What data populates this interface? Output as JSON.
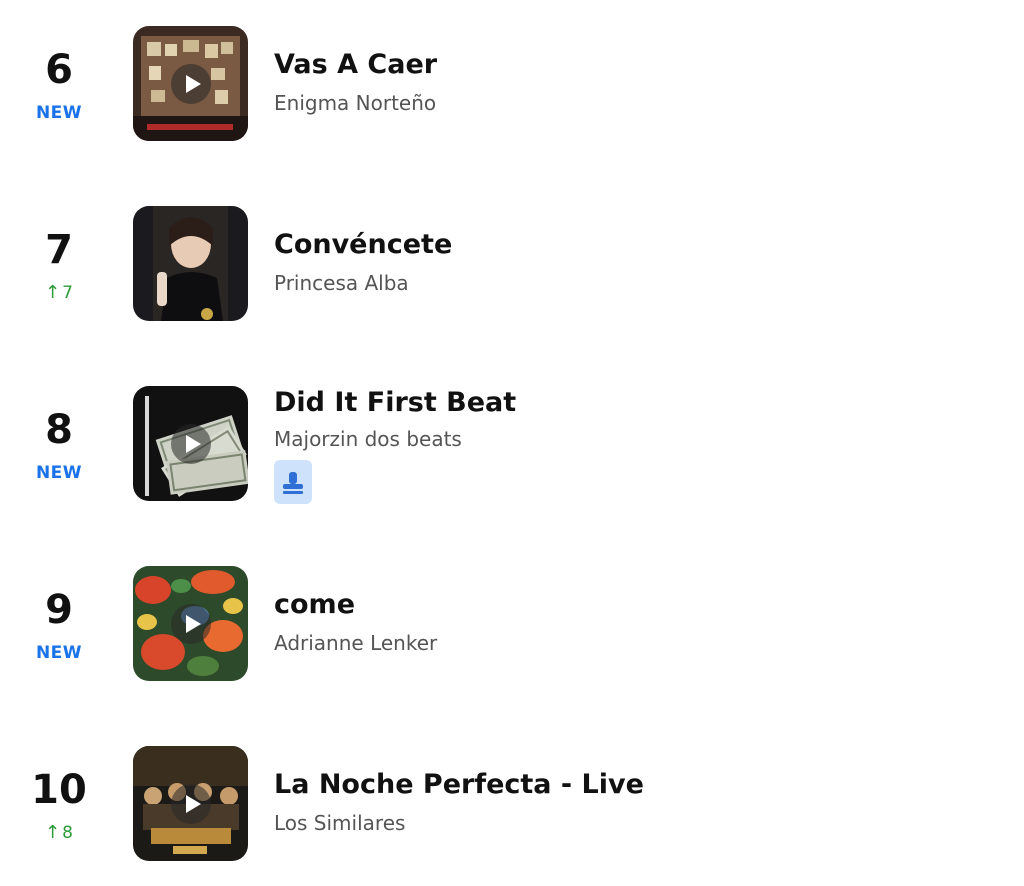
{
  "chart": {
    "entries": [
      {
        "rank": "6",
        "movement": "NEW",
        "movement_type": "new",
        "title": "Vas A Caer",
        "artist": "Enigma Norteño",
        "has_play_button": true,
        "has_badge": false
      },
      {
        "rank": "7",
        "movement": "7",
        "movement_type": "up",
        "title": "Convéncete",
        "artist": "Princesa Alba",
        "has_play_button": false,
        "has_badge": false
      },
      {
        "rank": "8",
        "movement": "NEW",
        "movement_type": "new",
        "title": "Did It First Beat",
        "artist": "Majorzin dos beats",
        "has_play_button": true,
        "has_badge": true,
        "badge_icon": "stamp-icon"
      },
      {
        "rank": "9",
        "movement": "NEW",
        "movement_type": "new",
        "title": "come",
        "artist": "Adrianne Lenker",
        "has_play_button": true,
        "has_badge": false
      },
      {
        "rank": "10",
        "movement": "8",
        "movement_type": "up",
        "title": "La Noche Perfecta - Live",
        "artist": "Los Similares",
        "has_play_button": true,
        "has_badge": false
      }
    ]
  },
  "colors": {
    "new_label": "#1a73e8",
    "up_arrow": "#2e9b3a",
    "badge_bg": "#cfe2fb"
  },
  "icons": {
    "play": "play-icon",
    "up": "arrow-up-icon",
    "badge": "stamp-icon"
  }
}
